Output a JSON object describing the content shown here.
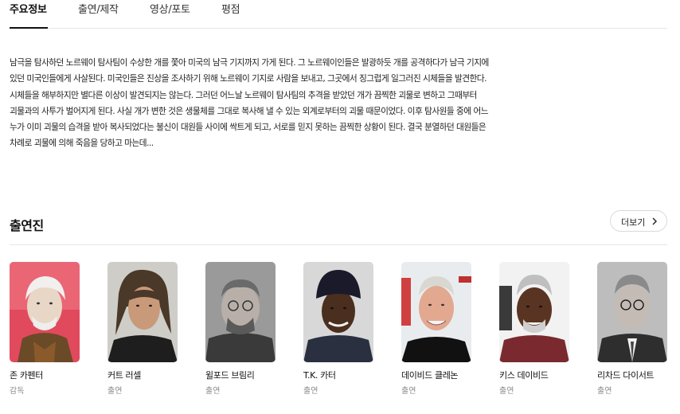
{
  "tabs": [
    {
      "label": "주요정보"
    },
    {
      "label": "출연/제작"
    },
    {
      "label": "영상/포토"
    },
    {
      "label": "평점"
    }
  ],
  "synopsis": "남극을 탐사하던 노르웨이 탐사팀이 수상한 개를 쫓아 미국의 남극 기지까지 가게 된다. 그 노르웨이인들은 발광하듯 개를 공격하다가 남극 기지에 있던 미국인들에게 사살된다. 미국인들은 진상을 조사하기 위해 노르웨이 기지로 사람을 보내고, 그곳에서 징그럽게 일그러진 시체들을 발견한다. 시체들을 해부하지만 별다른 이상이 발견되지는 않는다. 그러던 어느날 노르웨이 탐사팀의 추격을 받았던 개가 끔찍한 괴물로 변하고 그때부터 괴물과의 사투가 벌어지게 된다. 사실 개가 변한 것은 생물체를 그대로 복사해 낼 수 있는 외계로부터의 괴물 때문이었다. 이후 탐사원들 중에 어느 누가 이미 괴물의 습격을 받아 복사되었다는 불신이 대원들 사이에 싹트게 되고, 서로를 믿지 못하는 끔찍한 상황이 된다. 결국 분열하던 대원들은 차례로 괴물에 의해 죽음을 당하고 마는데...",
  "cast": {
    "title": "출연진",
    "more_label": "더보기",
    "members": [
      {
        "name": "존 카펜터",
        "role": "감독"
      },
      {
        "name": "커트 러셀",
        "role": "출연"
      },
      {
        "name": "윌포드 브림리",
        "role": "출연"
      },
      {
        "name": "T.K. 카터",
        "role": "출연"
      },
      {
        "name": "데이비드 클레논",
        "role": "출연"
      },
      {
        "name": "키스 데이비드",
        "role": "출연"
      },
      {
        "name": "리차드 다이서트",
        "role": "출연"
      }
    ]
  },
  "colors": {
    "accent": "#111111",
    "muted": "#8a8a8a",
    "divider": "#e6e6e6"
  }
}
